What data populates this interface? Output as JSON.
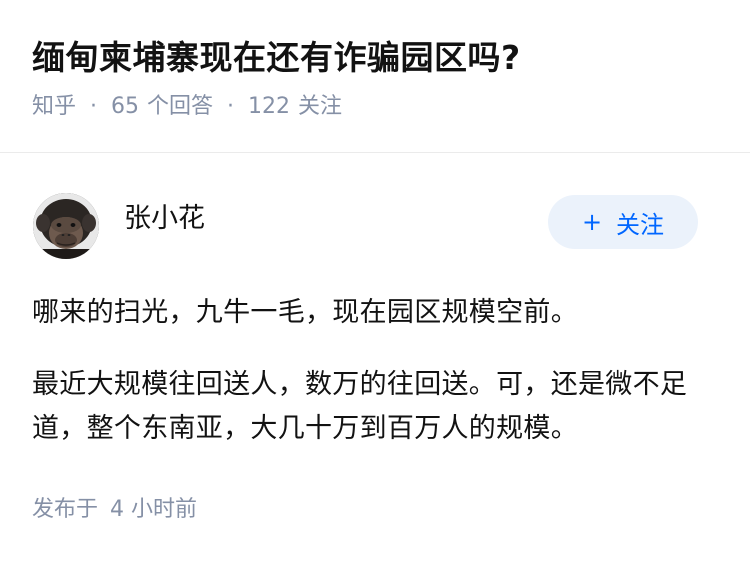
{
  "question": {
    "title": "缅甸柬埔寨现在还有诈骗园区吗?",
    "source": "知乎",
    "separator": "·",
    "answer_count": "65",
    "answer_unit": "个回答",
    "follower_count": "122",
    "follower_unit": "关注"
  },
  "answer": {
    "author_name": "张小花",
    "follow_button": {
      "plus": "+",
      "label": "关注"
    },
    "paragraphs": [
      "哪来的扫光，九牛一毛，现在园区规模空前。",
      "最近大规模往回送人，数万的往回送。可，还是微不足道，整个东南亚，大几十万到百万人的规模。"
    ],
    "published_label": "发布于",
    "published_time": "4 小时前"
  },
  "colors": {
    "meta_text": "#8590a6",
    "follow_bg": "#ebf2fb",
    "follow_text": "#0066ff"
  }
}
